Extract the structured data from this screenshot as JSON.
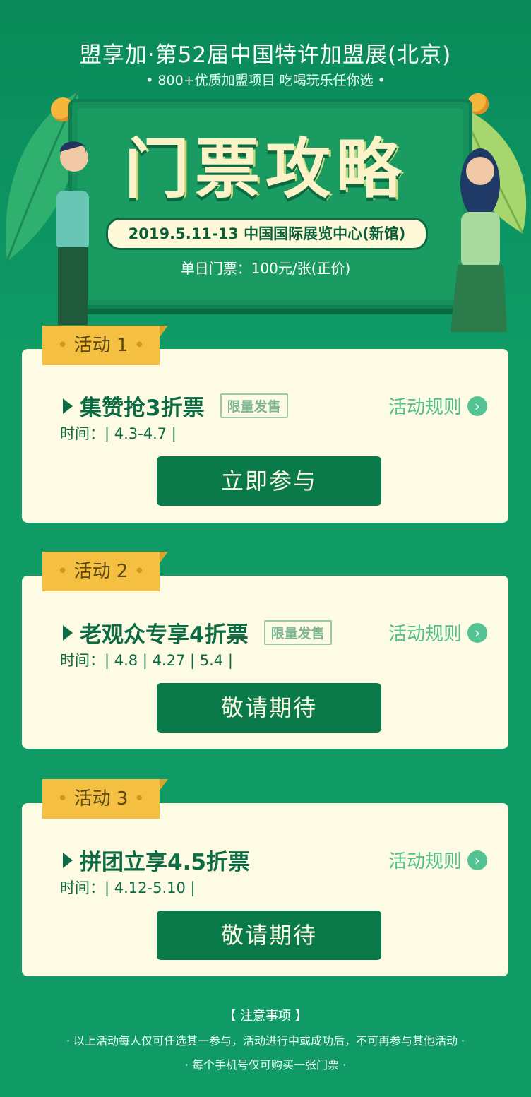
{
  "header": {
    "title": "盟享加·第52届中国特许加盟展(北京)",
    "subtitle": "• 800+优质加盟项目 吃喝玩乐任你选 •"
  },
  "hero": {
    "board_title": "门票攻略",
    "date_location": "2019.5.11-13 中国国际展览中心(新馆)",
    "price": "单日门票：100元/张(正价)"
  },
  "activities": [
    {
      "tag": "活动 1",
      "title": "集赞抢3折票",
      "badge": "限量发售",
      "rules_label": "活动规则",
      "time": "时间：| 4.3-4.7 |",
      "button": "立即参与"
    },
    {
      "tag": "活动 2",
      "title": "老观众专享4折票",
      "badge": "限量发售",
      "rules_label": "活动规则",
      "time": "时间：| 4.8 | 4.27 | 5.4 |",
      "button": "敬请期待"
    },
    {
      "tag": "活动 3",
      "title": "拼团立享4.5折票",
      "badge": "",
      "rules_label": "活动规则",
      "time": "时间：| 4.12-5.10 |",
      "button": "敬请期待"
    }
  ],
  "notes": {
    "title": "【 注意事项 】",
    "lines": [
      "· 以上活动每人仅可任选其一参与，活动进行中或成功后，不可再参与其他活动 ·",
      "· 每个手机号仅可购买一张门票 ·"
    ]
  },
  "colors": {
    "background": "#0f9a66",
    "card": "#fdfbe4",
    "button": "#0b7a4a",
    "tag": "#f5c042",
    "accent_green": "#54c393"
  }
}
